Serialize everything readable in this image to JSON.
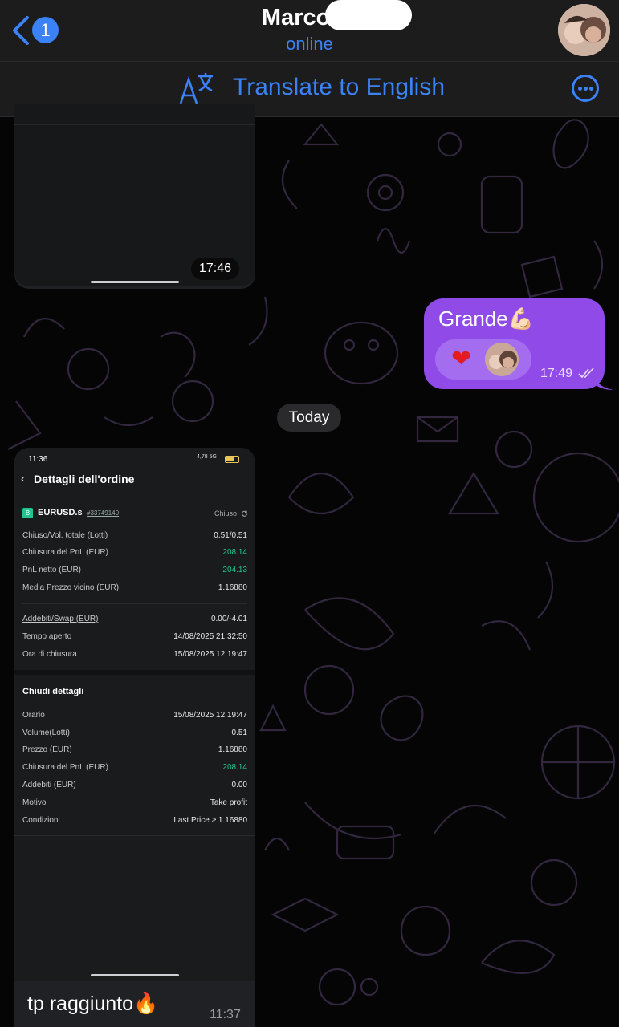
{
  "header": {
    "back_badge": "1",
    "contact_name": "Marco Li",
    "status": "online"
  },
  "translate_bar": {
    "icon": "translate-icon",
    "label": "Translate to English"
  },
  "messages": {
    "top_image_time": "17:46",
    "outgoing": {
      "text": "Grande💪🏻",
      "reaction": "❤️",
      "time": "17:49",
      "status_icon": "double-check-icon"
    },
    "date_separator": "Today",
    "screenshot": {
      "status_time": "11:36",
      "signal_text": "4,78 5G",
      "page_title": "Dettagli dell'ordine",
      "symbol": "EURUSD.s",
      "order_id": "#33749140",
      "state": "Chiuso",
      "rows_top": [
        {
          "label": "Chiuso/Vol. totale (Lotti)",
          "value": "0.51/0.51"
        },
        {
          "label": "Chiusura del PnL (EUR)",
          "value": "208.14"
        },
        {
          "label": "PnL netto (EUR)",
          "value": "204.13"
        },
        {
          "label": "Media Prezzo vicino (EUR)",
          "value": "1.16880"
        }
      ],
      "rows_mid": [
        {
          "label": "Addebiti/Swap (EUR)",
          "value": "0.00/-4.01"
        },
        {
          "label": "Tempo aperto",
          "value": "14/08/2025 21:32:50"
        },
        {
          "label": "Ora di chiusura",
          "value": "15/08/2025 12:19:47"
        }
      ],
      "section_title": "Chiudi dettagli",
      "rows_bottom": [
        {
          "label": "Orario",
          "value": "15/08/2025 12:19:47"
        },
        {
          "label": "Volume(Lotti)",
          "value": "0.51"
        },
        {
          "label": "Prezzo (EUR)",
          "value": "1.16880"
        },
        {
          "label": "Chiusura del PnL (EUR)",
          "value": "208.14"
        },
        {
          "label": "Addebiti (EUR)",
          "value": "0.00"
        },
        {
          "label": "Motivo",
          "value": "Take profit"
        },
        {
          "label": "Condizioni",
          "value": "Last Price ≥ 1.16880"
        }
      ]
    },
    "caption": {
      "text": "tp raggiunto🔥",
      "time": "11:37"
    }
  },
  "colors": {
    "accent": "#3b82f6",
    "outgoing_bubble": "#8f4ae8",
    "profit_green": "#22c38e",
    "header_bg": "#1c1c1d"
  }
}
